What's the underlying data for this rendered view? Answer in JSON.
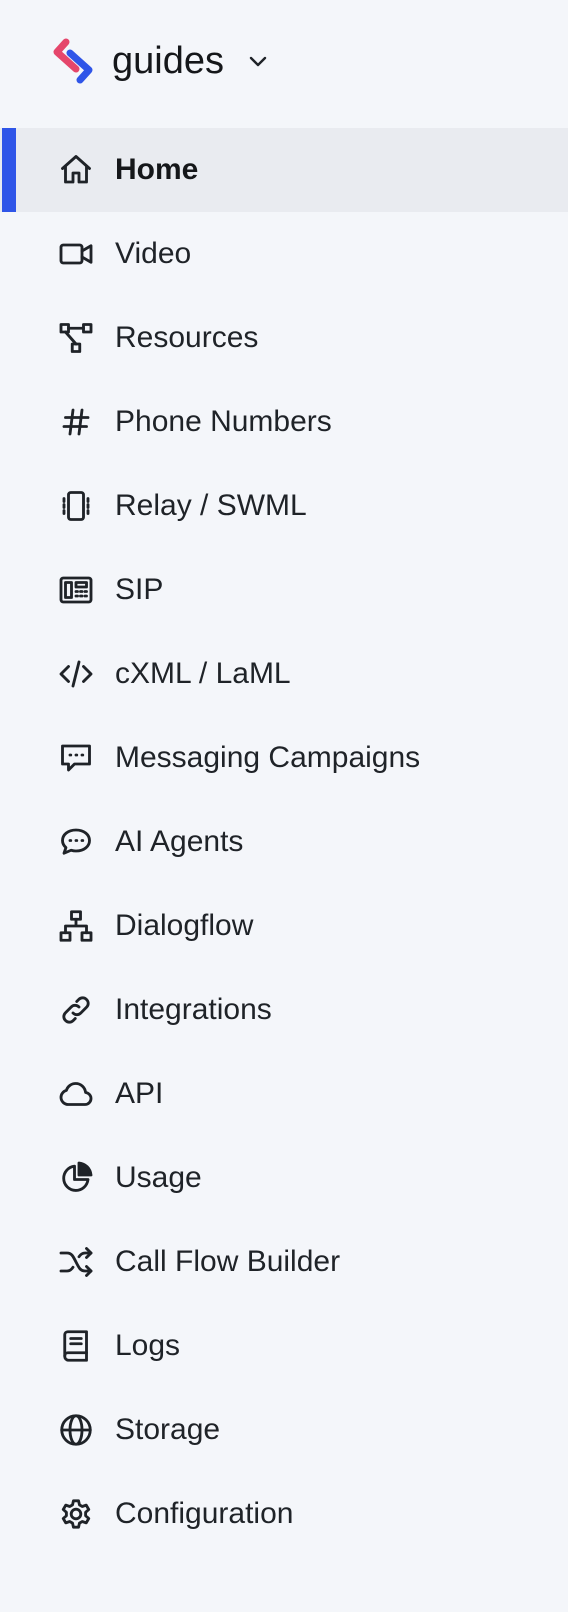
{
  "workspace": {
    "name": "guides",
    "logo_colors": [
      "#e5466b",
      "#2f55e8"
    ]
  },
  "accent_color": "#2f55e8",
  "active_item": "Home",
  "nav": {
    "items": [
      {
        "label": "Home",
        "icon": "home-icon"
      },
      {
        "label": "Video",
        "icon": "video-camera-icon"
      },
      {
        "label": "Resources",
        "icon": "resources-icon"
      },
      {
        "label": "Phone Numbers",
        "icon": "hash-icon"
      },
      {
        "label": "Relay / SWML",
        "icon": "phone-vibrate-icon"
      },
      {
        "label": "SIP",
        "icon": "desk-phone-icon"
      },
      {
        "label": "cXML / LaML",
        "icon": "code-icon"
      },
      {
        "label": "Messaging Campaigns",
        "icon": "chat-square-icon"
      },
      {
        "label": "AI Agents",
        "icon": "chat-bubble-icon"
      },
      {
        "label": "Dialogflow",
        "icon": "sitemap-icon"
      },
      {
        "label": "Integrations",
        "icon": "link-icon"
      },
      {
        "label": "API",
        "icon": "cloud-icon"
      },
      {
        "label": "Usage",
        "icon": "pie-chart-icon"
      },
      {
        "label": "Call Flow Builder",
        "icon": "shuffle-icon"
      },
      {
        "label": "Logs",
        "icon": "book-icon"
      },
      {
        "label": "Storage",
        "icon": "globe-icon"
      },
      {
        "label": "Configuration",
        "icon": "gear-icon"
      }
    ]
  }
}
